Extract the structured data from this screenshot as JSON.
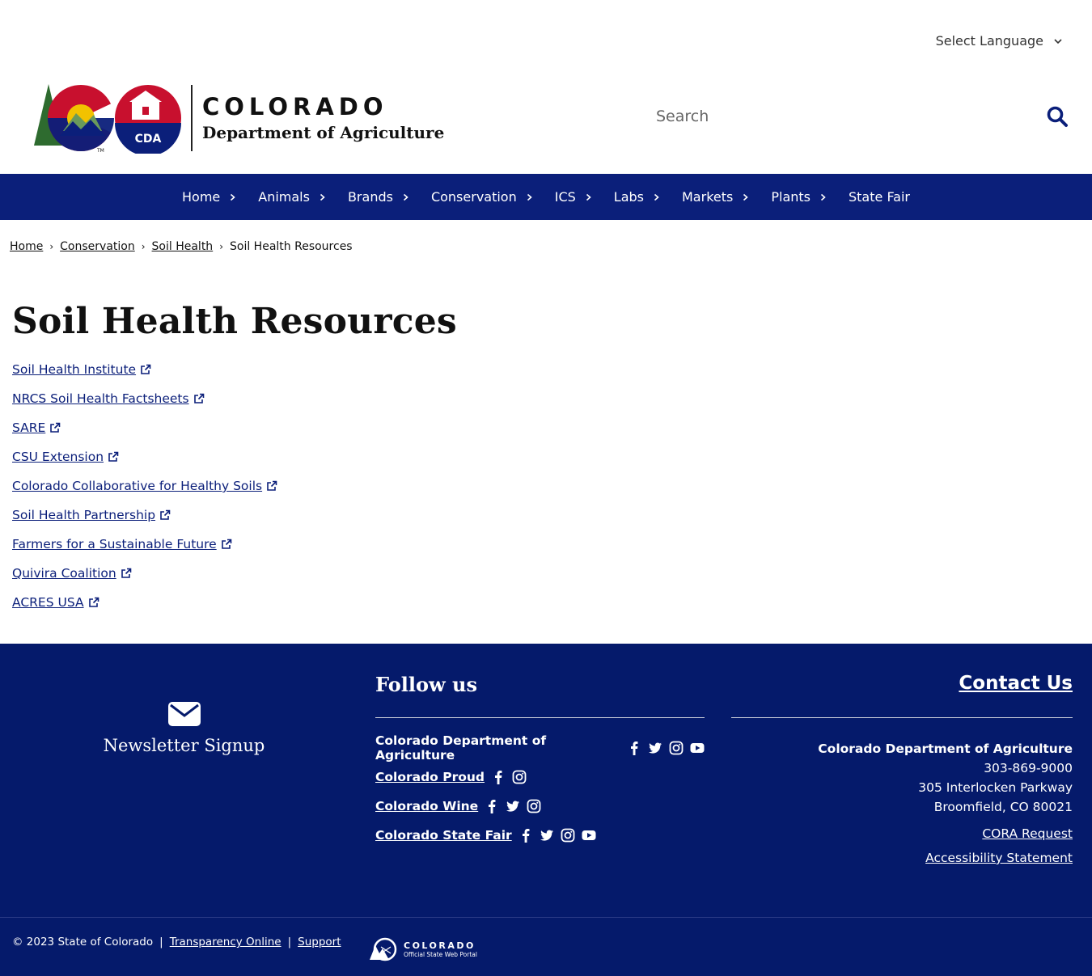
{
  "language_select": {
    "label": "Select Language"
  },
  "header": {
    "logo_title": "COLORADO",
    "logo_subtitle": "Department of Agriculture",
    "logo_badge": "CDA",
    "logo_tm": "TM",
    "search_placeholder": "Search"
  },
  "nav": {
    "items": [
      {
        "label": "Home"
      },
      {
        "label": "Animals"
      },
      {
        "label": "Brands"
      },
      {
        "label": "Conservation"
      },
      {
        "label": "ICS"
      },
      {
        "label": "Labs"
      },
      {
        "label": "Markets"
      },
      {
        "label": "Plants"
      },
      {
        "label": "State Fair"
      }
    ]
  },
  "breadcrumb": {
    "items": [
      "Home",
      "Conservation",
      "Soil Health"
    ],
    "current": "Soil Health Resources"
  },
  "page": {
    "title": "Soil Health Resources",
    "links": [
      "Soil Health Institute",
      "NRCS Soil Health Factsheets",
      "SARE",
      "CSU Extension",
      "Colorado Collaborative for Healthy Soils",
      "Soil Health Partnership",
      "Farmers for a Sustainable Future",
      "Quivira Coalition",
      "ACRES USA"
    ]
  },
  "footer": {
    "newsletter_label": "Newsletter Signup",
    "follow_title": "Follow us",
    "social": [
      {
        "name": "Colorado Department of Agriculture",
        "icons": [
          "facebook-icon",
          "twitter-icon",
          "instagram-icon",
          "youtube-icon"
        ]
      },
      {
        "name": "Colorado Proud",
        "icons": [
          "facebook-icon",
          "instagram-icon"
        ]
      },
      {
        "name": "Colorado Wine",
        "icons": [
          "facebook-icon",
          "twitter-icon",
          "instagram-icon"
        ]
      },
      {
        "name": "Colorado State Fair",
        "icons": [
          "facebook-icon",
          "twitter-icon",
          "instagram-icon",
          "youtube-icon"
        ]
      }
    ],
    "contact_title": "Contact Us",
    "contact_org": "Colorado Department of Agriculture",
    "contact_phone": "303-869-9000",
    "contact_address1": "305 Interlocken Parkway",
    "contact_address2": "Broomfield, CO 80021",
    "cora_link": "CORA Request",
    "accessibility_link": "Accessibility Statement",
    "copyright": "© 2023 State of Colorado",
    "separator": "|",
    "transparency_link": "Transparency Online",
    "support_link": "Support",
    "portal_title": "COLORADO",
    "portal_subtitle": "Official State Web Portal"
  },
  "colors": {
    "nav_bg": "#0b1f7a",
    "footer_bg": "#051a6b",
    "link": "#0b1f7a",
    "logo_red": "#c8102e",
    "logo_blue": "#0b1f7a",
    "logo_gold": "#f2c200",
    "logo_green": "#2e6b2f"
  }
}
